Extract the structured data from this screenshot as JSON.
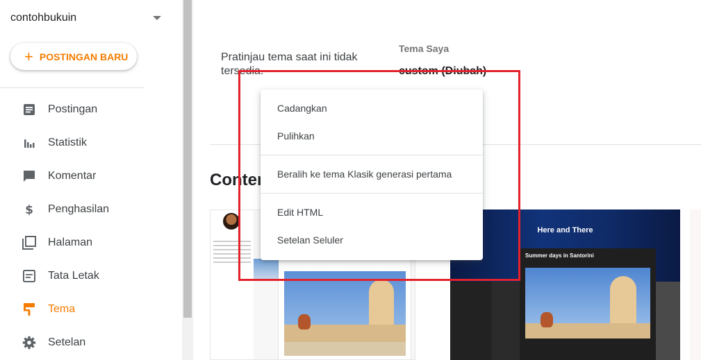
{
  "sidebar": {
    "blog_name": "contohbukuin",
    "new_post_label": "POSTINGAN BARU",
    "items": [
      {
        "label": "Postingan",
        "icon": "posts-icon"
      },
      {
        "label": "Statistik",
        "icon": "stats-icon"
      },
      {
        "label": "Komentar",
        "icon": "comment-icon"
      },
      {
        "label": "Penghasilan",
        "icon": "dollar-icon"
      },
      {
        "label": "Halaman",
        "icon": "pages-icon"
      },
      {
        "label": "Tata Letak",
        "icon": "layout-icon"
      },
      {
        "label": "Tema",
        "icon": "theme-paint-roller-icon",
        "active": true
      },
      {
        "label": "Setelan",
        "icon": "gear-icon"
      }
    ]
  },
  "main": {
    "preview_text": "Pratinjau tema saat ini tidak tersedia.",
    "my_theme_label": "Tema Saya",
    "theme_name": "custom (Diubah)",
    "section_title": "Contempo",
    "thumbnails": {
      "second_header_title": "Here and There",
      "second_post_title": "Summer days in Santorini"
    }
  },
  "menu": {
    "items": [
      "Cadangkan",
      "Pulihkan",
      "Beralih ke tema Klasik generasi pertama",
      "Edit HTML",
      "Setelan Seluler"
    ]
  },
  "colors": {
    "accent": "#f57c00",
    "highlight": "#e3222c"
  }
}
